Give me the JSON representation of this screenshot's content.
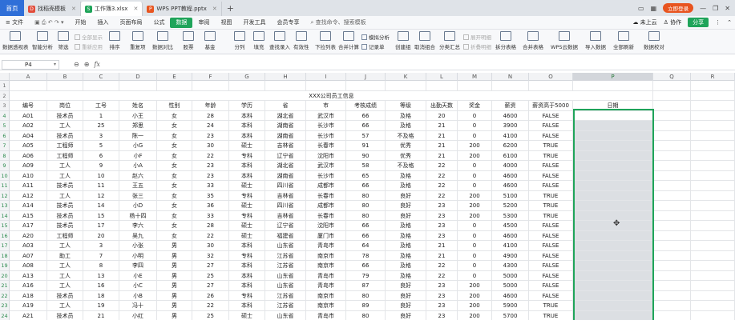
{
  "tabs": {
    "home": "首页",
    "docs": [
      {
        "label": "找稻壳模板",
        "icon_color": "#e24c3a",
        "icon": "D"
      },
      {
        "label": "工作簿3.xlsx",
        "icon_color": "#1fa45a",
        "icon": "S"
      },
      {
        "label": "WPS PPT教程.pptx",
        "icon_color": "#e8541f",
        "icon": "P"
      }
    ],
    "new_tab": "+"
  },
  "window": {
    "login_label": "立即登录",
    "min": "—",
    "restore": "❐",
    "close": "✕"
  },
  "menu": {
    "file": "≡ 文件",
    "items": [
      "开始",
      "插入",
      "页面布局",
      "公式",
      "数据",
      "审阅",
      "视图",
      "开发工具",
      "会员专享"
    ],
    "active_index": 4,
    "search": "查找命令、搜索模板",
    "cloud": "未上云",
    "collab": "协作",
    "share": "分享"
  },
  "ribbon": {
    "pivot": "数据透视表",
    "smart": "智能分析",
    "filter": "筛选",
    "show_all": "全部显示",
    "reapply": "重新应用",
    "sort": "排序",
    "duplicates": "重复项",
    "compare": "数据对比",
    "stock": "股票",
    "fund": "基金",
    "split": "分列",
    "fill": "填充",
    "lookup": "查找录入",
    "validity": "有效性",
    "dropdown": "下拉列表",
    "consolidate": "合并计算",
    "whatif": "模拟分析",
    "record": "记录单",
    "group": "创建组",
    "ungroup": "取消组合",
    "subtotal": "分类汇总",
    "expand": "展开明细",
    "collapse": "折叠明细",
    "split_table": "拆分表格",
    "merge_table": "合并表格",
    "wps_cloud": "WPS云数据",
    "import": "导入数据",
    "refresh": "全部刷新",
    "validate": "数据校对"
  },
  "formula_bar": {
    "cell_ref": "P4",
    "fx": "fx",
    "zoom_icon": "⊖",
    "check_icon": "⊕"
  },
  "columns": [
    "A",
    "B",
    "C",
    "D",
    "E",
    "F",
    "G",
    "H",
    "I",
    "J",
    "K",
    "L",
    "M",
    "N",
    "O",
    "P",
    "Q",
    "R"
  ],
  "selected_column": "P",
  "sheet_title": "XXX公司员工信息",
  "headers": [
    "编号",
    "岗位",
    "工号",
    "姓名",
    "性别",
    "年龄",
    "学历",
    "省",
    "市",
    "考核成绩",
    "等级",
    "出勤天数",
    "奖金",
    "薪资",
    "薪资高于5000",
    "日期"
  ],
  "rows": [
    {
      "n": "4",
      "cells": [
        "A01",
        "技术员",
        "1",
        "小王",
        "女",
        "28",
        "本科",
        "湖北省",
        "武汉市",
        "66",
        "及格",
        "20",
        "0",
        "4600",
        "FALSE"
      ]
    },
    {
      "n": "5",
      "cells": [
        "A02",
        "工人",
        "25",
        "郑思",
        "女",
        "24",
        "本科",
        "湖南省",
        "长沙市",
        "66",
        "及格",
        "21",
        "0",
        "3900",
        "FALSE"
      ]
    },
    {
      "n": "6",
      "cells": [
        "A04",
        "技术员",
        "3",
        "陈一",
        "女",
        "23",
        "本科",
        "湖南省",
        "长沙市",
        "57",
        "不及格",
        "21",
        "0",
        "4100",
        "FALSE"
      ]
    },
    {
      "n": "7",
      "cells": [
        "A05",
        "工程师",
        "5",
        "小G",
        "女",
        "30",
        "硕士",
        "吉林省",
        "长春市",
        "91",
        "优秀",
        "21",
        "200",
        "6200",
        "TRUE"
      ]
    },
    {
      "n": "8",
      "cells": [
        "A06",
        "工程师",
        "6",
        "小F",
        "女",
        "22",
        "专科",
        "辽宁省",
        "沈阳市",
        "90",
        "优秀",
        "21",
        "200",
        "6100",
        "TRUE"
      ]
    },
    {
      "n": "9",
      "cells": [
        "A09",
        "工人",
        "9",
        "小A",
        "女",
        "23",
        "本科",
        "湖北省",
        "武汉市",
        "58",
        "不及格",
        "22",
        "0",
        "4000",
        "FALSE"
      ]
    },
    {
      "n": "10",
      "cells": [
        "A10",
        "工人",
        "10",
        "赵六",
        "女",
        "23",
        "本科",
        "湖南省",
        "长沙市",
        "65",
        "及格",
        "22",
        "0",
        "4600",
        "FALSE"
      ]
    },
    {
      "n": "11",
      "cells": [
        "A11",
        "技术员",
        "11",
        "王五",
        "女",
        "33",
        "硕士",
        "四川省",
        "成都市",
        "66",
        "及格",
        "22",
        "0",
        "4600",
        "FALSE"
      ]
    },
    {
      "n": "12",
      "cells": [
        "A12",
        "工人",
        "12",
        "张三",
        "女",
        "35",
        "专科",
        "吉林省",
        "长春市",
        "80",
        "良好",
        "22",
        "200",
        "5100",
        "TRUE"
      ]
    },
    {
      "n": "13",
      "cells": [
        "A14",
        "技术员",
        "14",
        "小D",
        "女",
        "36",
        "硕士",
        "四川省",
        "成都市",
        "80",
        "良好",
        "23",
        "200",
        "5200",
        "TRUE"
      ]
    },
    {
      "n": "14",
      "cells": [
        "A15",
        "技术员",
        "15",
        "杨十四",
        "女",
        "33",
        "专科",
        "吉林省",
        "长春市",
        "80",
        "良好",
        "23",
        "200",
        "5300",
        "TRUE"
      ]
    },
    {
      "n": "15",
      "cells": [
        "A17",
        "技术员",
        "17",
        "李六",
        "女",
        "28",
        "硕士",
        "辽宁省",
        "沈阳市",
        "66",
        "及格",
        "23",
        "0",
        "4500",
        "FALSE"
      ]
    },
    {
      "n": "16",
      "cells": [
        "A20",
        "工程师",
        "20",
        "吴九",
        "女",
        "22",
        "硕士",
        "福建省",
        "厦门市",
        "66",
        "及格",
        "23",
        "0",
        "4600",
        "FALSE"
      ]
    },
    {
      "n": "17",
      "cells": [
        "A03",
        "工人",
        "3",
        "小张",
        "男",
        "30",
        "本科",
        "山东省",
        "青岛市",
        "64",
        "及格",
        "21",
        "0",
        "4100",
        "FALSE"
      ]
    },
    {
      "n": "18",
      "cells": [
        "A07",
        "助工",
        "7",
        "小明",
        "男",
        "32",
        "专科",
        "江苏省",
        "南京市",
        "78",
        "及格",
        "21",
        "0",
        "4900",
        "FALSE"
      ]
    },
    {
      "n": "19",
      "cells": [
        "A08",
        "工人",
        "8",
        "李四",
        "男",
        "27",
        "本科",
        "江苏省",
        "南京市",
        "66",
        "及格",
        "22",
        "0",
        "4300",
        "FALSE"
      ]
    },
    {
      "n": "20",
      "cells": [
        "A13",
        "工人",
        "13",
        "小E",
        "男",
        "25",
        "本科",
        "山东省",
        "青岛市",
        "79",
        "及格",
        "22",
        "0",
        "5000",
        "FALSE"
      ]
    },
    {
      "n": "21",
      "cells": [
        "A16",
        "工人",
        "16",
        "小C",
        "男",
        "27",
        "本科",
        "山东省",
        "青岛市",
        "87",
        "良好",
        "23",
        "200",
        "5000",
        "FALSE"
      ]
    },
    {
      "n": "22",
      "cells": [
        "A18",
        "技术员",
        "18",
        "小B",
        "男",
        "26",
        "专科",
        "江苏省",
        "南京市",
        "80",
        "良好",
        "23",
        "200",
        "4600",
        "FALSE"
      ]
    },
    {
      "n": "23",
      "cells": [
        "A19",
        "工人",
        "19",
        "冯十",
        "男",
        "22",
        "本科",
        "江苏省",
        "南京市",
        "89",
        "良好",
        "23",
        "200",
        "5900",
        "TRUE"
      ]
    },
    {
      "n": "24",
      "cells": [
        "A21",
        "技术员",
        "21",
        "小红",
        "男",
        "25",
        "硕士",
        "山东省",
        "青岛市",
        "80",
        "良好",
        "23",
        "200",
        "5700",
        "TRUE"
      ]
    },
    {
      "n": "25",
      "cells": [
        "A22",
        "助工",
        "22",
        "孙七",
        "男",
        "27",
        "专科",
        "湖南省",
        "长沙市",
        "66",
        "及格",
        "23",
        "0",
        "4600",
        "FALSE"
      ]
    }
  ]
}
